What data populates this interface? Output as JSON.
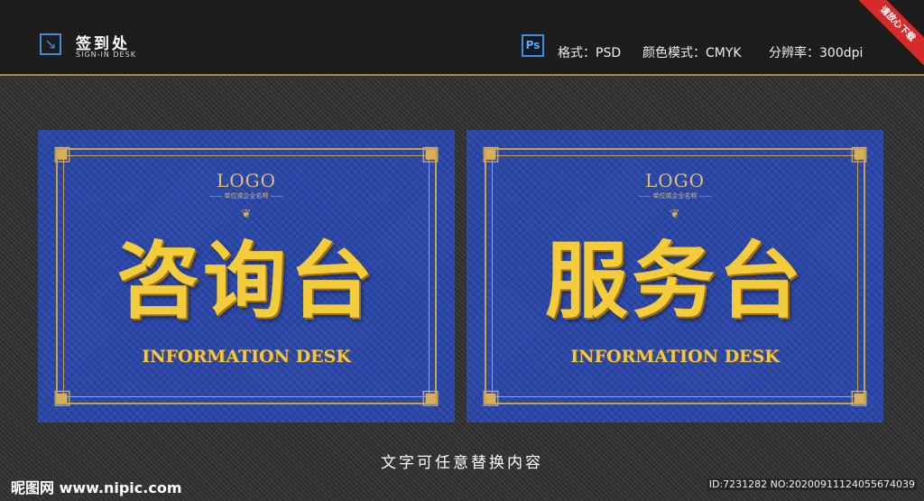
{
  "header": {
    "title": "签到处",
    "subtitle": "SIGN-IN DESK",
    "ps_icon": "Ps",
    "format": "格式：PSD",
    "color_mode": "颜色模式：CMYK",
    "resolution": "分辨率：300dpi",
    "ribbon": "请放心下载"
  },
  "cards": [
    {
      "logo": "LOGO",
      "company": "—— 单位或企业名称 ——",
      "title": "咨询台",
      "english": "INFORMATION DESK"
    },
    {
      "logo": "LOGO",
      "company": "—— 单位或企业名称 ——",
      "title": "服务台",
      "english": "INFORMATION DESK"
    }
  ],
  "caption": "文字可任意替换内容",
  "watermark": "昵图网 www.nipic.com",
  "image_id": "ID:7231282 NO:20200911124055674039",
  "icons": {
    "brand": "arrow-down-right-icon",
    "corner": "fretwork-corner-icon",
    "flourish": "ornament-flourish-icon"
  },
  "colors": {
    "card_blue": "#2a47a8",
    "gold": "#f3cc3c",
    "header_bg": "#1f1c1d"
  }
}
